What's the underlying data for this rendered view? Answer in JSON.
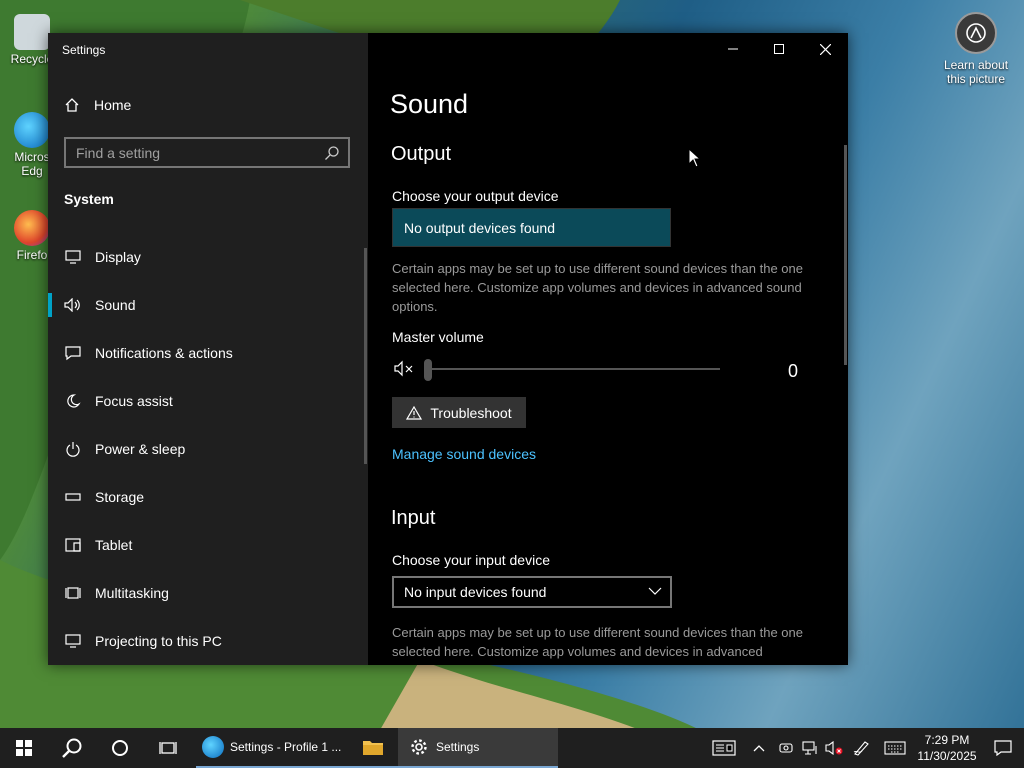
{
  "desktop": {
    "icons": [
      {
        "label": "Recycle"
      },
      {
        "label": "Micros Edg"
      },
      {
        "label": "Firefo"
      }
    ],
    "learn_about": "Learn about this picture"
  },
  "window": {
    "title": "Settings",
    "controls": {
      "minimize": "minimize",
      "maximize": "maximize",
      "close": "close"
    }
  },
  "sidebar": {
    "home": "Home",
    "search_placeholder": "Find a setting",
    "section": "System",
    "items": [
      {
        "label": "Display",
        "icon": "display-icon"
      },
      {
        "label": "Sound",
        "icon": "speaker-icon",
        "active": true
      },
      {
        "label": "Notifications & actions",
        "icon": "notification-icon"
      },
      {
        "label": "Focus assist",
        "icon": "moon-icon"
      },
      {
        "label": "Power & sleep",
        "icon": "power-icon"
      },
      {
        "label": "Storage",
        "icon": "storage-icon"
      },
      {
        "label": "Tablet",
        "icon": "tablet-icon"
      },
      {
        "label": "Multitasking",
        "icon": "multitasking-icon"
      },
      {
        "label": "Projecting to this PC",
        "icon": "projecting-icon"
      }
    ]
  },
  "main": {
    "page_title": "Sound",
    "output": {
      "heading": "Output",
      "device_label": "Choose your output device",
      "device_value": "No output devices found",
      "description": "Certain apps may be set up to use different sound devices than the one selected here. Customize app volumes and devices in advanced sound options.",
      "master_volume_label": "Master volume",
      "master_volume_value": "0",
      "troubleshoot": "Troubleshoot",
      "manage_link": "Manage sound devices"
    },
    "input": {
      "heading": "Input",
      "device_label": "Choose your input device",
      "device_value": "No input devices found",
      "description": "Certain apps may be set up to use different sound devices than the one selected here. Customize app volumes and devices in advanced"
    }
  },
  "taskbar": {
    "apps": [
      {
        "label": "Settings - Profile 1 ...",
        "icon": "edge-icon"
      },
      {
        "label": "",
        "icon": "file-explorer-icon"
      },
      {
        "label": "Settings",
        "icon": "gear-icon"
      }
    ],
    "time": "7:29 PM",
    "date": "11/30/2025"
  },
  "colors": {
    "accent": "#00a2c7",
    "output_device_bg": "#0b4a59",
    "link": "#4cc2ff"
  }
}
